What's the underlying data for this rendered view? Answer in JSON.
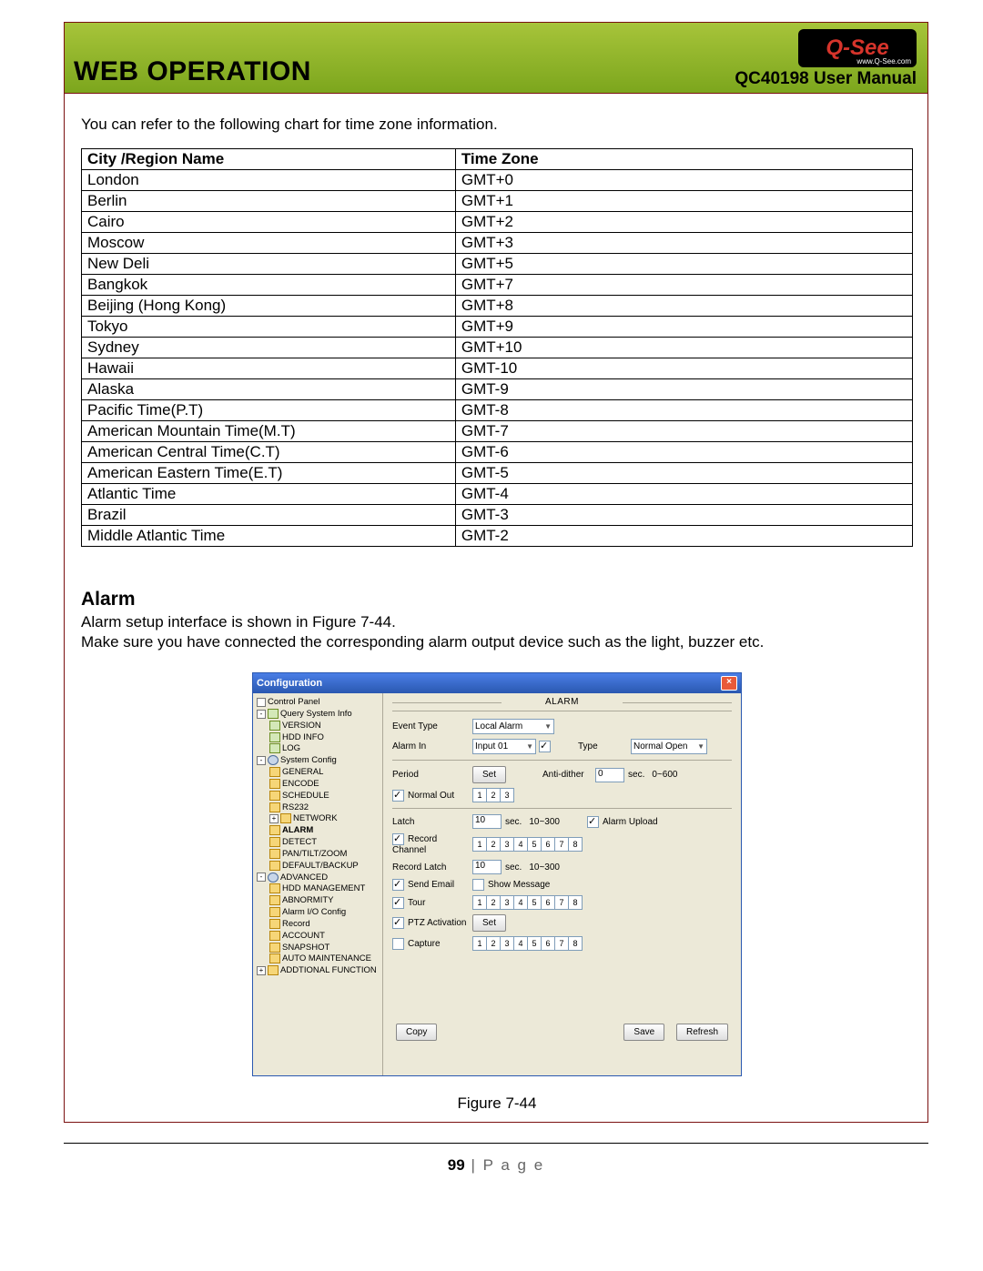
{
  "header": {
    "section": "WEB OPERATION",
    "logo_text": "Q-See",
    "logo_url": "www.Q-See.com",
    "manual": "QC40198 User Manual"
  },
  "intro": "You can refer to the following chart for time zone information.",
  "chart_data": {
    "type": "table",
    "title": "Time zone information",
    "headers": [
      "City /Region Name",
      "Time Zone"
    ],
    "rows": [
      [
        "London",
        "GMT+0"
      ],
      [
        "Berlin",
        "GMT+1"
      ],
      [
        "Cairo",
        "GMT+2"
      ],
      [
        "Moscow",
        "GMT+3"
      ],
      [
        "New Deli",
        "GMT+5"
      ],
      [
        "Bangkok",
        "GMT+7"
      ],
      [
        "Beijing (Hong Kong)",
        "GMT+8"
      ],
      [
        "Tokyo",
        "GMT+9"
      ],
      [
        "Sydney",
        "GMT+10"
      ],
      [
        "Hawaii",
        "GMT-10"
      ],
      [
        "Alaska",
        "GMT-9"
      ],
      [
        "Pacific Time(P.T)",
        "GMT-8"
      ],
      [
        "American  Mountain Time(M.T)",
        "GMT-7"
      ],
      [
        "American Central Time(C.T)",
        "GMT-6"
      ],
      [
        "American Eastern Time(E.T)",
        "GMT-5"
      ],
      [
        "Atlantic Time",
        "GMT-4"
      ],
      [
        "Brazil",
        "GMT-3"
      ],
      [
        "Middle Atlantic Time",
        "GMT-2"
      ]
    ]
  },
  "alarm": {
    "heading": "Alarm",
    "line1": "Alarm setup interface is shown in Figure 7-44.",
    "line2": "Make sure you have connected the corresponding alarm output device such as the light, buzzer etc."
  },
  "win": {
    "title": "Configuration",
    "panel_title": "ALARM",
    "tree": [
      {
        "indent": 0,
        "icon": "box",
        "exp": "",
        "label": "Control Panel"
      },
      {
        "indent": 0,
        "icon": "box",
        "exp": "-",
        "label": "Query System Info",
        "iconc": "file"
      },
      {
        "indent": 1,
        "icon": "file",
        "label": "VERSION"
      },
      {
        "indent": 1,
        "icon": "file",
        "label": "HDD INFO"
      },
      {
        "indent": 1,
        "icon": "file",
        "label": "LOG"
      },
      {
        "indent": 0,
        "icon": "box",
        "exp": "-",
        "label": "System Config",
        "iconc": "gear"
      },
      {
        "indent": 1,
        "icon": "fold",
        "label": "GENERAL"
      },
      {
        "indent": 1,
        "icon": "fold",
        "label": "ENCODE"
      },
      {
        "indent": 1,
        "icon": "fold",
        "label": "SCHEDULE"
      },
      {
        "indent": 1,
        "icon": "fold",
        "label": "RS232"
      },
      {
        "indent": 1,
        "icon": "box",
        "exp": "+",
        "label": "NETWORK",
        "iconc": "fold"
      },
      {
        "indent": 1,
        "icon": "fold",
        "label": "ALARM",
        "bold": true
      },
      {
        "indent": 1,
        "icon": "fold",
        "label": "DETECT"
      },
      {
        "indent": 1,
        "icon": "fold",
        "label": "PAN/TILT/ZOOM"
      },
      {
        "indent": 1,
        "icon": "fold",
        "label": "DEFAULT/BACKUP"
      },
      {
        "indent": 0,
        "icon": "box",
        "exp": "-",
        "label": "ADVANCED",
        "iconc": "gear"
      },
      {
        "indent": 1,
        "icon": "fold",
        "label": "HDD MANAGEMENT"
      },
      {
        "indent": 1,
        "icon": "fold",
        "label": "ABNORMITY"
      },
      {
        "indent": 1,
        "icon": "fold",
        "label": "Alarm I/O Config"
      },
      {
        "indent": 1,
        "icon": "fold",
        "label": "Record"
      },
      {
        "indent": 1,
        "icon": "fold",
        "label": "ACCOUNT"
      },
      {
        "indent": 1,
        "icon": "fold",
        "label": "SNAPSHOT"
      },
      {
        "indent": 1,
        "icon": "fold",
        "label": "AUTO MAINTENANCE"
      },
      {
        "indent": 0,
        "icon": "box",
        "exp": "+",
        "label": "ADDTIONAL FUNCTION",
        "iconc": "fold"
      }
    ],
    "form": {
      "event_type": {
        "label": "Event Type",
        "value": "Local Alarm"
      },
      "alarm_in": {
        "label": "Alarm In",
        "value": "Input 01"
      },
      "type": {
        "label": "Type",
        "value": "Normal Open"
      },
      "period": {
        "label": "Period",
        "button": "Set"
      },
      "antidither": {
        "label": "Anti-dither",
        "value": "0",
        "unit": "sec.",
        "range": "0~600"
      },
      "normal_out": {
        "label": "Normal Out",
        "channels": [
          1,
          2,
          3
        ]
      },
      "latch": {
        "label": "Latch",
        "value": "10",
        "unit": "sec.",
        "range": "10~300"
      },
      "alarm_upload": {
        "label": "Alarm Upload"
      },
      "record_channel": {
        "label": "Record Channel",
        "channels": [
          1,
          2,
          3,
          4,
          5,
          6,
          7,
          8
        ]
      },
      "record_latch": {
        "label": "Record Latch",
        "value": "10",
        "unit": "sec.",
        "range": "10~300"
      },
      "send_email": {
        "label": "Send Email"
      },
      "show_message": {
        "label": "Show Message"
      },
      "tour": {
        "label": "Tour",
        "channels": [
          1,
          2,
          3,
          4,
          5,
          6,
          7,
          8
        ]
      },
      "ptz": {
        "label": "PTZ Activation",
        "button": "Set"
      },
      "capture": {
        "label": "Capture",
        "channels": [
          1,
          2,
          3,
          4,
          5,
          6,
          7,
          8
        ]
      }
    },
    "buttons": {
      "copy": "Copy",
      "save": "Save",
      "refresh": "Refresh"
    }
  },
  "figure_caption": "Figure 7-44",
  "footer": {
    "num": "99",
    "sep": "|",
    "word": "P a g e"
  }
}
